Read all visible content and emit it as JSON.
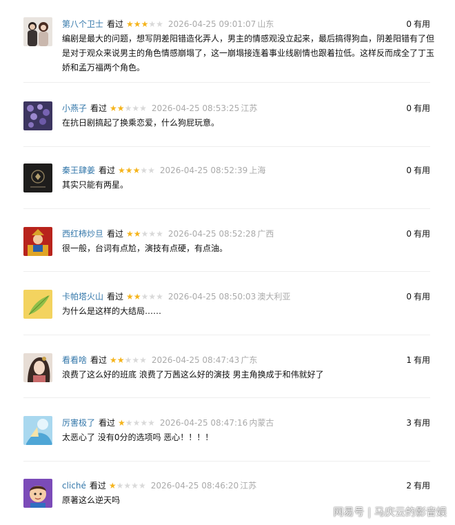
{
  "watched_label": "看过",
  "useful_suffix": "有用",
  "star_colors": {
    "on": "#f5b41c",
    "off": "#d9d9d9"
  },
  "reviews": [
    {
      "user": "第八个卫士",
      "stars": 3,
      "time": "2026-04-25 09:01:07",
      "location": "山东",
      "useful": "0",
      "avatar": "couple-photo",
      "content": "编剧是最大的问题，想写阴差阳错造化弄人，男主的情感观没立起来，最后搞得狗血，阴差阳错有了但是对于观众来说男主的角色情感崩塌了，这一崩塌接连着事业线剧情也跟着拉低。这样反而成全了丁玉娇和孟万福两个角色。"
    },
    {
      "user": "小燕子",
      "stars": 2,
      "time": "2026-04-25 08:53:25",
      "location": "江苏",
      "useful": "0",
      "avatar": "lavender-flowers",
      "content": "在抗日剧搞起了换乘恋爱，什么狗屁玩意。"
    },
    {
      "user": "秦王肆姜",
      "stars": 3,
      "time": "2026-04-25 08:52:39",
      "location": "上海",
      "useful": "0",
      "avatar": "dark-emblem",
      "content": "其实只能有两星。"
    },
    {
      "user": "西红柿炒旦",
      "stars": 2,
      "time": "2026-04-25 08:52:28",
      "location": "广西",
      "useful": "0",
      "avatar": "red-deity",
      "content": "很一般，台词有点尬，演技有点硬，有点油。"
    },
    {
      "user": "卡帕塔火山",
      "stars": 2,
      "time": "2026-04-25 08:50:03",
      "location": "澳大利亚",
      "useful": "0",
      "avatar": "yellow-leaf",
      "content": "为什么是这样的大结局……"
    },
    {
      "user": "看看啥",
      "stars": 2,
      "time": "2026-04-25 08:47:43",
      "location": "广东",
      "useful": "1",
      "avatar": "costume-woman",
      "content": "浪费了这么好的班底 浪费了万茜这么好的演技 男主角换成于和伟就好了"
    },
    {
      "user": "厉害极了",
      "stars": 1,
      "time": "2026-04-25 08:47:16",
      "location": "内蒙古",
      "useful": "3",
      "avatar": "blue-fantasy",
      "content": "太恶心了 没有0分的选项吗 恶心！！！！"
    },
    {
      "user": "cliché",
      "stars": 1,
      "time": "2026-04-25 08:46:20",
      "location": "江苏",
      "useful": "2",
      "avatar": "cartoon-boy",
      "content": "原著这么逆天吗"
    }
  ],
  "watermark": "网易号 | 马庆云的影音娱"
}
